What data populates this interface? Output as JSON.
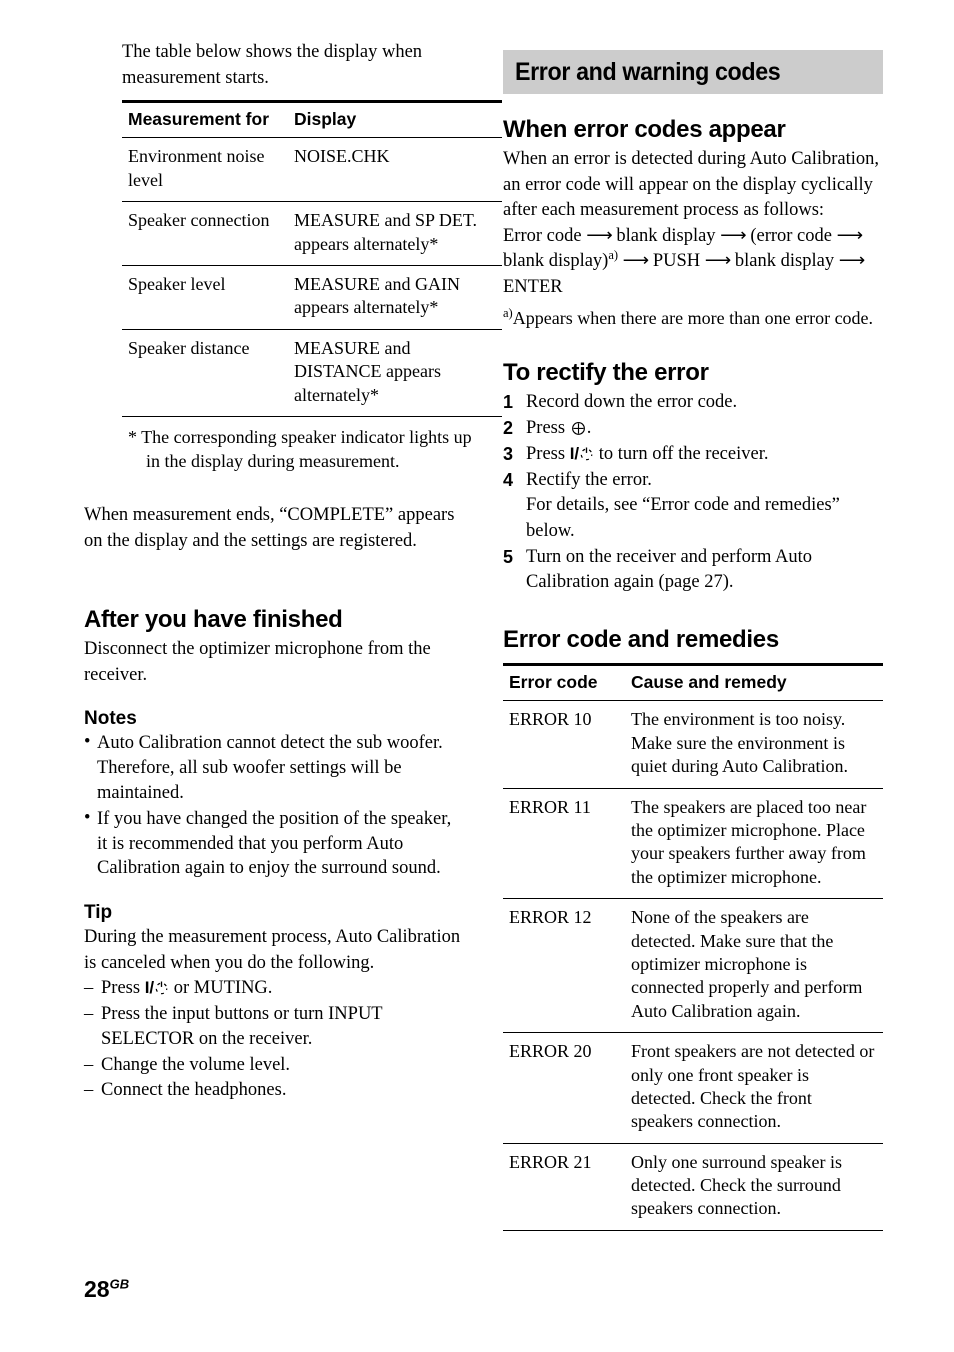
{
  "page": {
    "number": "28",
    "locale_suffix": "GB"
  },
  "left_column": {
    "intro_paragraph": "The table below shows the display when measurement starts.",
    "measurement_table": {
      "headers": [
        "Measurement for",
        "Display"
      ],
      "rows": [
        {
          "measurement_for": "Environment noise level",
          "display": "NOISE.CHK"
        },
        {
          "measurement_for": "Speaker connection",
          "display": "MEASURE and SP DET. appears alternately*"
        },
        {
          "measurement_for": "Speaker level",
          "display": "MEASURE and GAIN appears alternately*"
        },
        {
          "measurement_for": "Speaker distance",
          "display": "MEASURE and DISTANCE appears alternately*"
        }
      ],
      "footnote": "* The corresponding speaker indicator lights up in the display during measurement."
    },
    "complete_paragraph": "When measurement ends, “COMPLETE” appears on the display and the settings are registered.",
    "after_finished": {
      "heading": "After you have finished",
      "body": "Disconnect the optimizer microphone from the receiver."
    },
    "notes": {
      "heading": "Notes",
      "items": [
        "Auto Calibration cannot detect the sub woofer. Therefore, all sub woofer settings will be maintained.",
        "If you have changed the position of the speaker, it is recommended that you perform Auto Calibration again to enjoy the surround sound."
      ]
    },
    "tip": {
      "heading": "Tip",
      "intro": "During the measurement process, Auto Calibration is canceled when you do the following.",
      "items_pre": [
        "Press ",
        "Press the input buttons or turn INPUT SELECTOR on the receiver.",
        "Change the volume level.",
        "Connect the headphones."
      ],
      "item1_suffix": " or MUTING."
    }
  },
  "right_column": {
    "section_title": "Error and warning codes",
    "when_error_codes": {
      "heading": "When error codes appear",
      "paragraph": "When an error is detected during Auto Calibration, an error code will appear on the display cyclically after each measurement process as follows:",
      "flow": {
        "part1": "Error code",
        "part2": "blank display",
        "part3": "(error code",
        "part4": "blank display)",
        "superscript": "a)",
        "part5": "PUSH",
        "part6": "blank display",
        "part7": "ENTER",
        "arrow": "⟶"
      },
      "footnote_marker": "a)",
      "footnote_text": "Appears when there are more than one error code."
    },
    "rectify": {
      "heading": "To rectify the error",
      "steps": [
        {
          "text": "Record down the error code."
        },
        {
          "text_before": "Press ",
          "symbol": "circle-plus",
          "text_after": "."
        },
        {
          "text_before": "Press ",
          "symbol": "power",
          "text_after": " to turn off the receiver."
        },
        {
          "text": "Rectify the error.",
          "continuation": "For details, see “Error code and remedies” below."
        },
        {
          "text": "Turn on the receiver and perform Auto Calibration again (page 27)."
        }
      ]
    },
    "error_remedies": {
      "heading": "Error code and remedies",
      "headers": [
        "Error code",
        "Cause and remedy"
      ],
      "rows": [
        {
          "code": "ERROR 10",
          "remedy": "The environment is too noisy. Make sure the environment is quiet during Auto Calibration."
        },
        {
          "code": "ERROR 11",
          "remedy": "The speakers are placed too near the optimizer microphone. Place your speakers further away from the optimizer microphone."
        },
        {
          "code": "ERROR 12",
          "remedy": "None of the speakers are detected. Make sure that the optimizer microphone is connected properly and perform Auto Calibration again."
        },
        {
          "code": "ERROR 20",
          "remedy": "Front speakers are not detected or only one front speaker is detected. Check the front speakers connection."
        },
        {
          "code": "ERROR 21",
          "remedy": "Only one surround speaker is detected. Check the surround speakers connection."
        }
      ]
    }
  },
  "colors": {
    "band_background": "#cccccc",
    "text": "#000000",
    "rule": "#000000"
  }
}
